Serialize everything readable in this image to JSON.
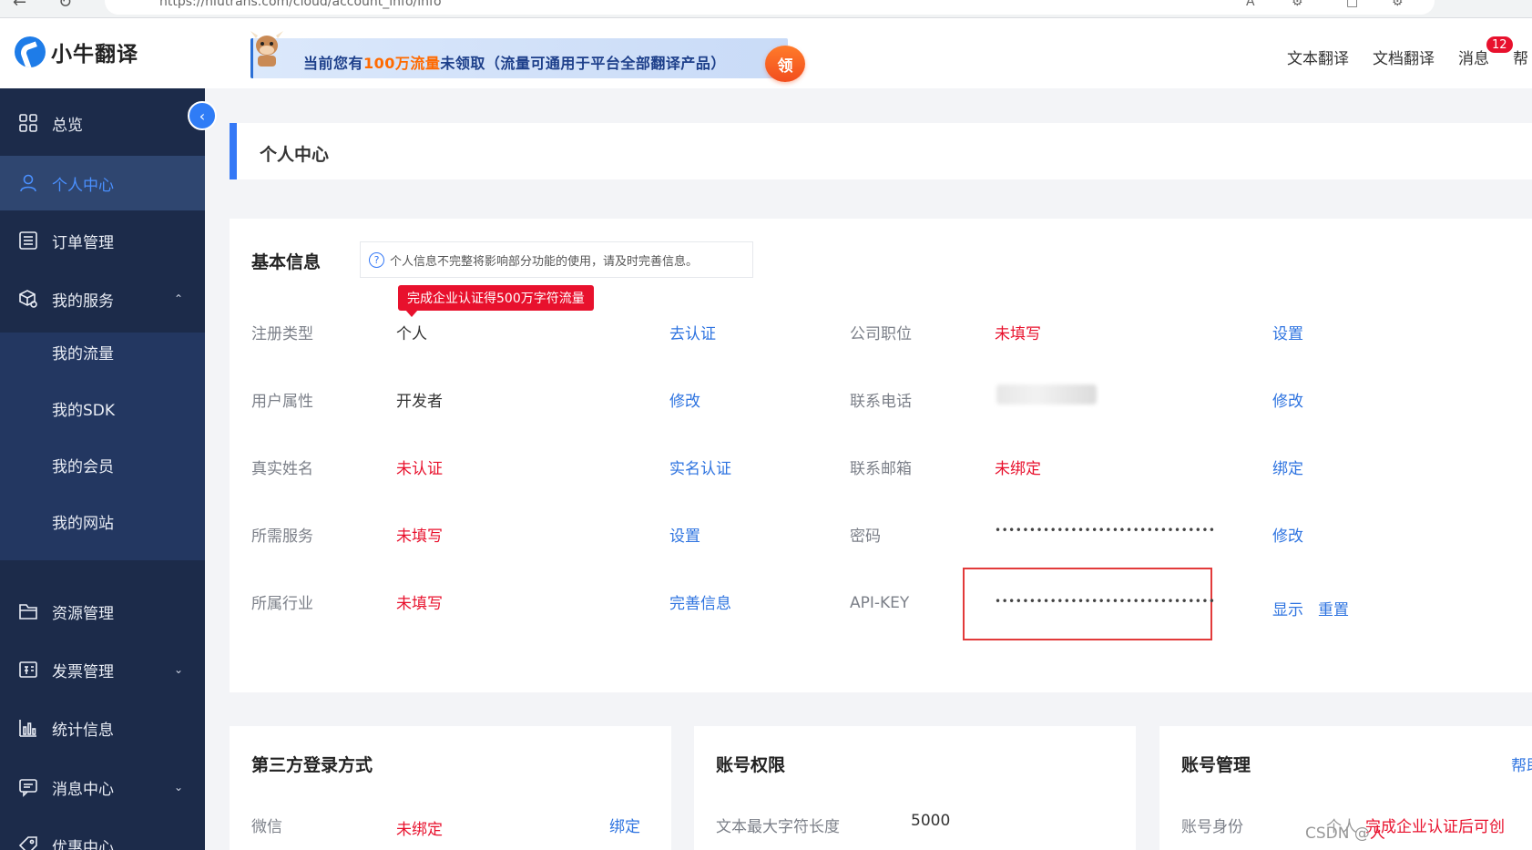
{
  "browser": {
    "url": "https://niutrans.com/cloud/account_info/info"
  },
  "header": {
    "logo_text": "小牛翻译",
    "banner": {
      "pre": "当前您有",
      "highlight": "100万流量",
      "post": "未领取（流量可通用于平台全部翻译产品）",
      "button": "领"
    },
    "nav": {
      "text_translate": "文本翻译",
      "doc_translate": "文档翻译",
      "messages": "消息",
      "help": "帮"
    },
    "message_count": "12"
  },
  "sidebar": {
    "items": {
      "overview": "总览",
      "personal": "个人中心",
      "orders": "订单管理",
      "services": "我的服务",
      "resources": "资源管理",
      "invoices": "发票管理",
      "stats": "统计信息",
      "messages": "消息中心",
      "offers": "优惠中心"
    },
    "services_sub": {
      "traffic": "我的流量",
      "sdk": "我的SDK",
      "member": "我的会员",
      "website": "我的网站"
    }
  },
  "page": {
    "title": "个人中心"
  },
  "basic_info": {
    "title": "基本信息",
    "tip": "个人信息不完整将影响部分功能的使用，请及时完善信息。",
    "promo_tag": "完成企业认证得500万字符流量",
    "left_rows": [
      {
        "label": "注册类型",
        "value": "个人",
        "action": "去认证"
      },
      {
        "label": "用户属性",
        "value": "开发者",
        "action": "修改"
      },
      {
        "label": "真实姓名",
        "value": "未认证",
        "action": "实名认证"
      },
      {
        "label": "所需服务",
        "value": "未填写",
        "action": "设置"
      },
      {
        "label": "所属行业",
        "value": "未填写",
        "action": "完善信息"
      }
    ],
    "right_rows": [
      {
        "label": "公司职位",
        "value": "未填写",
        "action": "设置"
      },
      {
        "label": "联系电话",
        "value": "",
        "action": "修改"
      },
      {
        "label": "联系邮箱",
        "value": "未绑定",
        "action": "绑定"
      },
      {
        "label": "密码",
        "value": "••••••••••••••••••••••••••••••••",
        "action": "修改"
      },
      {
        "label": "API-KEY",
        "value": "••••••••••••••••••••••••••••••••",
        "action": "显示",
        "action2": "重置"
      }
    ]
  },
  "third_party": {
    "title": "第三方登录方式",
    "label": "微信",
    "value": "未绑定",
    "action": "绑定"
  },
  "permissions": {
    "title": "账号权限",
    "label": "文本最大字符长度",
    "value": "5000"
  },
  "account_mgmt": {
    "title": "账号管理",
    "help": "帮助",
    "label": "账号身份",
    "value": "个人",
    "note": "完成企业认证后可创"
  },
  "watermark": {
    "pre": "CSDN @",
    "red": "人"
  }
}
